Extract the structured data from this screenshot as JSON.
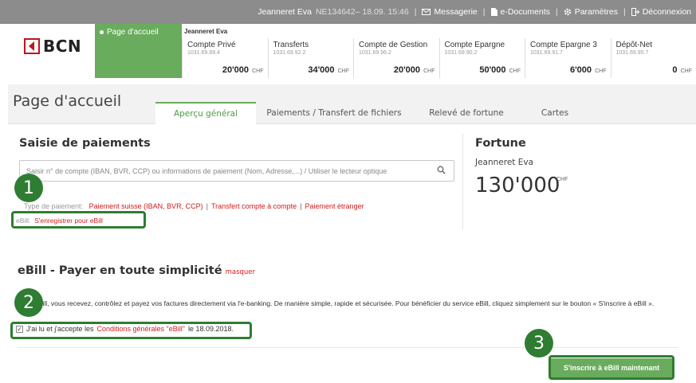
{
  "topbar": {
    "user": "Jeanneret Eva",
    "session": "NE134642– 18.09. 15:46",
    "links": [
      "Messagerie",
      "e-Documents",
      "Paramètres",
      "Déconnexion"
    ]
  },
  "header": {
    "logo_text": "BCN",
    "home_tile": "Page d'accueil",
    "owner": "Jeanneret Eva",
    "accounts": [
      {
        "name": "Compte Privé",
        "number": "1031.69.89.4",
        "balance": "20'000",
        "currency": "CHF"
      },
      {
        "name": "Transferts",
        "number": "1031.69.92.2",
        "balance": "34'000",
        "currency": "CHF"
      },
      {
        "name": "Compte de Gestion",
        "number": "1031.69.96.2",
        "balance": "20'000",
        "currency": "CHF"
      },
      {
        "name": "Compte Epargne",
        "number": "1031.69.90.2",
        "balance": "50'000",
        "currency": "CHF"
      },
      {
        "name": "Compte Epargne 3",
        "number": "1031.69.91.7",
        "balance": "6'000",
        "currency": "CHF"
      },
      {
        "name": "Dépôt-Net",
        "number": "1031.69.95.7",
        "balance": "0",
        "currency": "CHF"
      }
    ]
  },
  "page": {
    "title": "Page d'accueil",
    "tabs": [
      "Aperçu général",
      "Paiements / Transfert de fichiers",
      "Relevé de fortune",
      "Cartes"
    ]
  },
  "payments": {
    "title": "Saisie de paiements",
    "search_placeholder": "Saisir n° de compte (IBAN, BVR, CCP) ou informations de paiement (Nom, Adresse,...) / Utiliser le lecteur optique",
    "type_label": "Type de paiement:",
    "links": [
      "Paiement suisse (IBAN, BVR, CCP)",
      "Transfert compte à compte",
      "Paiement étranger"
    ],
    "ebill_label": "eBill:",
    "ebill_link": "S'enregistrer pour eBill"
  },
  "fortune": {
    "title": "Fortune",
    "owner": "Jeanneret Eva",
    "value": "130'000",
    "currency": "CHF"
  },
  "ebill": {
    "title": "eBill - Payer en toute simplicité",
    "hide": "masquer",
    "description": "Avec eBill, vous recevez, contrôlez et payez vos factures directement via l'e-banking. De manière simple, rapide et sécurisée. Pour bénéficier du service eBill, cliquez simplement sur le bouton « S'inscrire à eBill ».",
    "terms_pre": "J'ai lu et j'accepte les",
    "terms_link": "Conditions générales \"eBill\"",
    "terms_post": "le 18.09.2018.",
    "button": "S'inscrire à eBill maintenant"
  },
  "steps": [
    "1",
    "2",
    "3"
  ],
  "colors": {
    "topbar": "#8c8c8c",
    "brand_green": "#6aac5e",
    "overlay_green": "#2e7d32",
    "link_red": "#d21c1c",
    "logo_red": "#c0141c"
  }
}
